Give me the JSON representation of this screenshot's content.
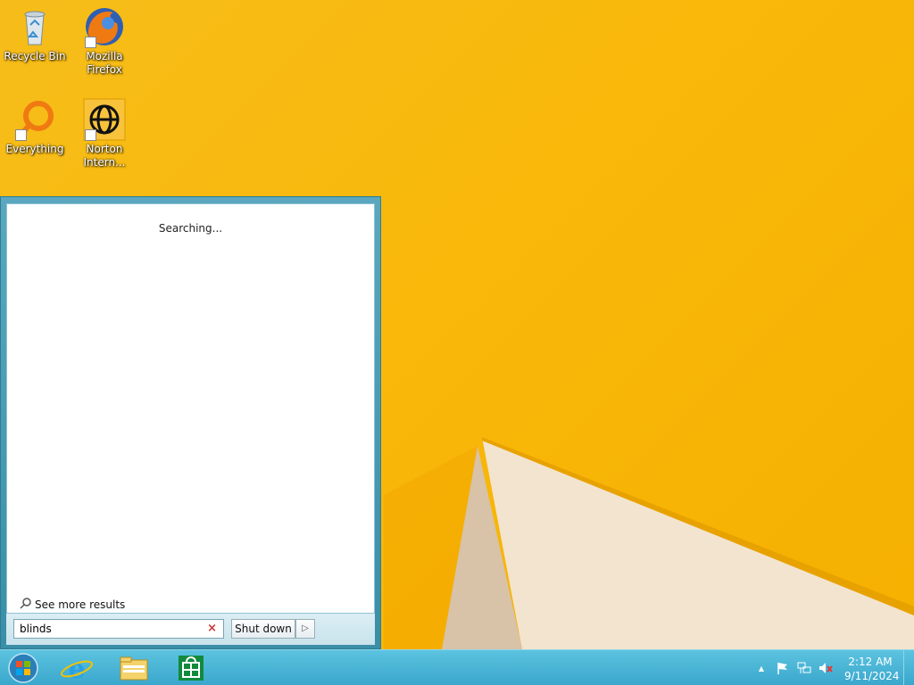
{
  "desktop": {
    "icons": [
      {
        "label": "Recycle Bin",
        "icon": "recycle-bin-icon"
      },
      {
        "label": "Mozilla Firefox",
        "icon": "firefox-icon"
      },
      {
        "label": "Everything",
        "icon": "everything-search-icon"
      },
      {
        "label": "Norton Intern...",
        "icon": "norton-icon"
      }
    ]
  },
  "start_menu": {
    "status_text": "Searching...",
    "see_more_label": "See more results",
    "search": {
      "value": "blinds",
      "clear_icon": "×"
    },
    "shutdown_label": "Shut down",
    "shutdown_arrow": "▷"
  },
  "taskbar": {
    "pinned": [
      {
        "icon": "start-orb-icon"
      },
      {
        "icon": "internet-explorer-icon"
      },
      {
        "icon": "file-explorer-icon"
      },
      {
        "icon": "store-icon"
      }
    ],
    "tray": {
      "overflow_glyph": "▲",
      "icons": [
        "action-center-flag-icon",
        "network-icon",
        "volume-muted-icon"
      ]
    },
    "clock": {
      "time": "2:12 AM",
      "date": "9/11/2024"
    }
  },
  "colors": {
    "wallpaper": "#f9b80a",
    "taskbar": "#4bb5d8",
    "start_frame": "#4a9cb5"
  }
}
